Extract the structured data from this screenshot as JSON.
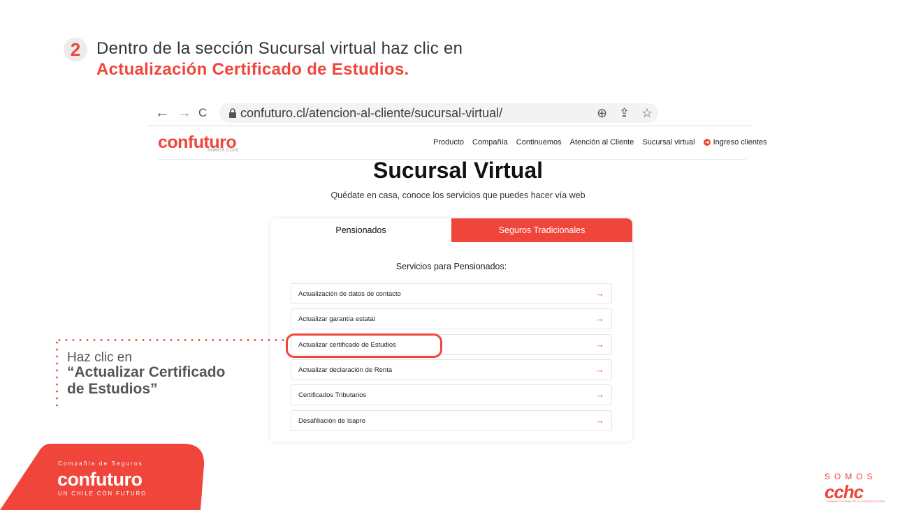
{
  "step": {
    "number": "2",
    "line1": "Dentro de la sección Sucursal virtual haz clic en",
    "line2": "Actualización Certificado de Estudios."
  },
  "browser": {
    "back_icon": "←",
    "forward_icon": "→",
    "reload_icon": "C",
    "url": "confuturo.cl/atencion-al-cliente/sucursal-virtual/",
    "zoom_icon": "⊕",
    "share_icon": "⇪",
    "star_icon": "☆"
  },
  "site": {
    "logo": "confuturo",
    "logo_sub": "SOMOS CChC",
    "nav": [
      "Producto",
      "Compañía",
      "Continuemos",
      "Atención al Cliente",
      "Sucursal virtual"
    ],
    "login": "Ingreso clientes"
  },
  "page": {
    "title": "Sucursal Virtual",
    "subtitle": "Quédate en casa, conoce los servicios que puedes hacer vía web"
  },
  "tabs": {
    "pensionados": "Pensionados",
    "seguros": "Seguros Tradicionales"
  },
  "services": {
    "title": "Servicios para Pensionados:",
    "items": [
      "Actualización de datos de contacto",
      "Actualizar garantía estatal",
      "Actualizar certificado de Estudios",
      "Actualizar declaración de Renta",
      "Certificados Tributarios",
      "Desafiliación de Isapre"
    ],
    "arrow": "→"
  },
  "callout": {
    "line1": "Haz clic en",
    "line2": "“Actualizar Certificado",
    "line3": "de Estudios”"
  },
  "brand": {
    "tagline": "Compañía de Seguros",
    "logo": "confuturo",
    "slogan": "UN CHILE CON FUTURO"
  },
  "cchc": {
    "somos": "SOMOS",
    "logo": "cchc",
    "sub": "CÁMARA CHILENA DE LA CONSTRUCCIÓN"
  },
  "colors": {
    "accent": "#f0453a"
  }
}
